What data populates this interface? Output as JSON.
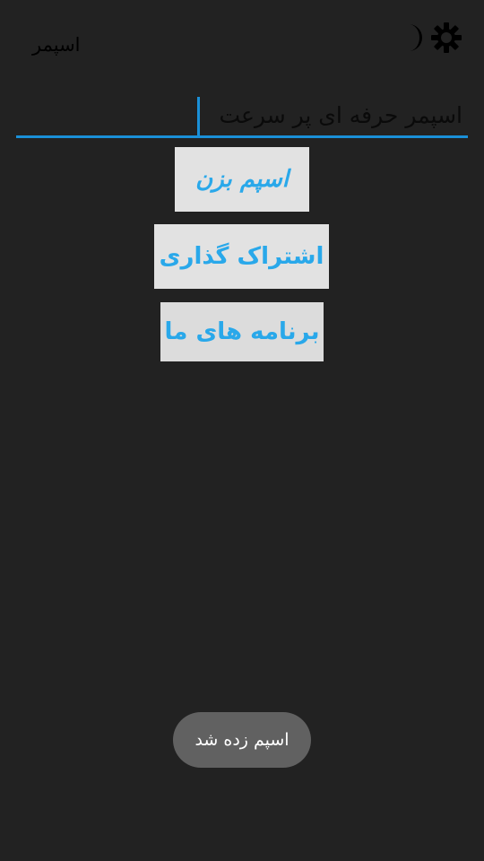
{
  "app": {
    "title": "اسپمر"
  },
  "action_bar": {
    "icons": [
      {
        "name": "moon-icon",
        "glyph": "☽"
      },
      {
        "name": "gear-icon",
        "glyph": "⚙"
      }
    ]
  },
  "input": {
    "value": "اسپمر حرفه ای پر سرعت"
  },
  "buttons": {
    "spam": "اسپم بزن",
    "share": "اشتراک گذاری",
    "apps": "برنامه های ما"
  },
  "toast": {
    "message": "اسپم زده شد"
  },
  "colors": {
    "background": "#222222",
    "accent": "#1a90d8",
    "button_text": "#29a8ea",
    "button_bg": "#e2e2e2",
    "toast_bg": "#616161"
  }
}
